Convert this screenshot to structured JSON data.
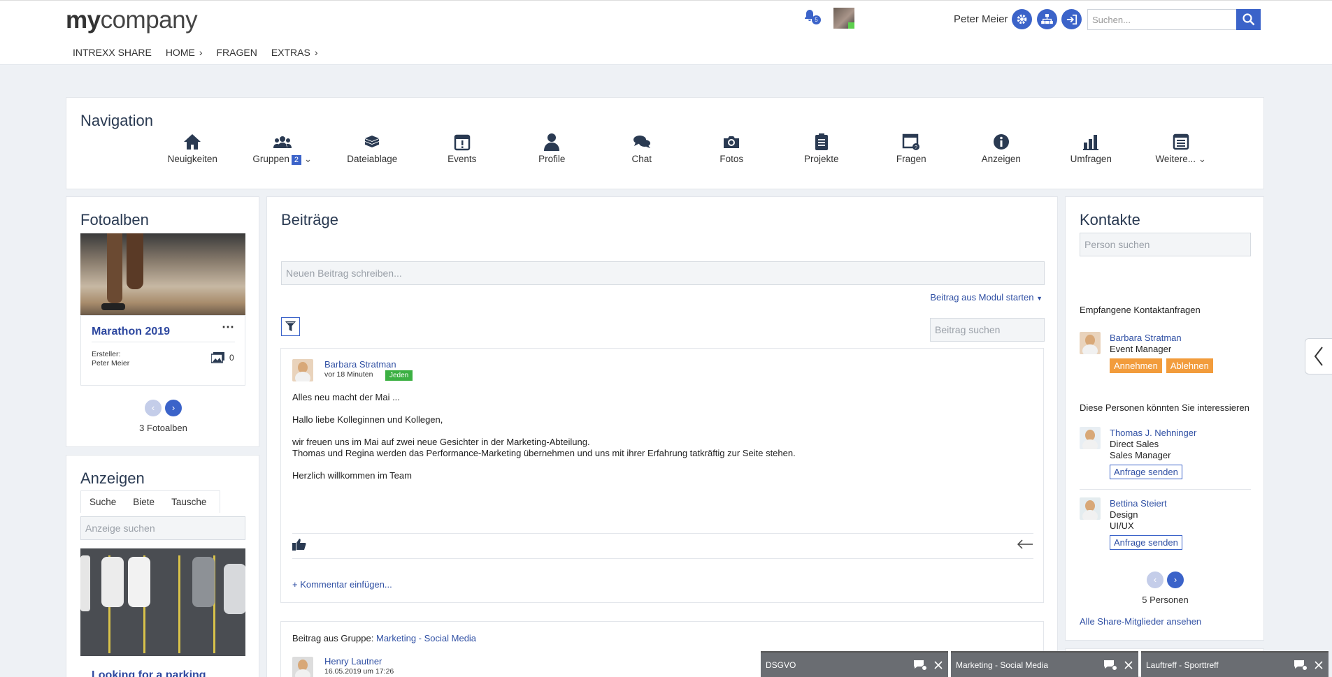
{
  "header": {
    "logo_bold": "my",
    "logo_rest": "company",
    "nav": [
      "INTREXX SHARE",
      "HOME",
      "FRAGEN",
      "EXTRAS"
    ],
    "notification_count": "5",
    "user_name": "Peter Meier",
    "search_placeholder": "Suchen..."
  },
  "navigation": {
    "title": "Navigation",
    "items": [
      {
        "label": "Neuigkeiten",
        "icon": "home-icon"
      },
      {
        "label": "Gruppen",
        "icon": "group-icon",
        "badge": "2"
      },
      {
        "label": "Dateiablage",
        "icon": "files-icon"
      },
      {
        "label": "Events",
        "icon": "calendar-icon"
      },
      {
        "label": "Profile",
        "icon": "person-icon"
      },
      {
        "label": "Chat",
        "icon": "chat-icon"
      },
      {
        "label": "Fotos",
        "icon": "camera-icon"
      },
      {
        "label": "Projekte",
        "icon": "clipboard-icon"
      },
      {
        "label": "Fragen",
        "icon": "question-window-icon"
      },
      {
        "label": "Anzeigen",
        "icon": "info-icon"
      },
      {
        "label": "Umfragen",
        "icon": "bar-chart-icon"
      },
      {
        "label": "Weitere...",
        "icon": "list-icon"
      }
    ]
  },
  "fotoalben": {
    "title": "Fotoalben",
    "album_title": "Marathon 2019",
    "creator_label": "Ersteller:",
    "creator": "Peter Meier",
    "photo_count": "0",
    "count_label": "3 Fotoalben"
  },
  "anzeigen": {
    "title": "Anzeigen",
    "tabs": [
      "Suche",
      "Biete",
      "Tausche"
    ],
    "search_placeholder": "Anzeige suchen",
    "item_title": "Looking for a parking"
  },
  "beitraege": {
    "title": "Beiträge",
    "new_post_placeholder": "Neuen Beitrag schreiben...",
    "module_link": "Beitrag aus Modul starten",
    "search_placeholder": "Beitrag suchen",
    "post1": {
      "author": "Barbara Stratman",
      "time": "vor 18 Minuten",
      "visibility": "Jeden",
      "line1": "Alles neu macht der Mai ...",
      "line2": "Hallo liebe Kolleginnen und Kollegen,",
      "line3": "wir freuen uns im Mai auf zwei neue Gesichter in der Marketing-Abteilung.",
      "line4": "Thomas und Regina werden das Performance-Marketing übernehmen und uns mit ihrer Erfahrung tatkräftig zur Seite stehen.",
      "line5": "Herzlich willkommen im Team",
      "comment_link": "+ Kommentar einfügen..."
    },
    "post2": {
      "group_prefix": "Beitrag aus Gruppe:",
      "group": "Marketing - Social Media",
      "author": "Henry Lautner",
      "time": "16.05.2019 um 17:26"
    }
  },
  "kontakte": {
    "title": "Kontakte",
    "search_placeholder": "Person suchen",
    "requests_title": "Empfangene Kontaktanfragen",
    "request": {
      "name": "Barbara Stratman",
      "role": "Event Manager",
      "accept": "Annehmen",
      "decline": "Ablehnen"
    },
    "suggest_title": "Diese Personen könnten Sie interessieren",
    "suggestions": [
      {
        "name": "Thomas J. Nehninger",
        "line1": "Direct Sales",
        "line2": "Sales Manager",
        "action": "Anfrage senden"
      },
      {
        "name": "Bettina Steiert",
        "line1": "Design",
        "line2": "UI/UX",
        "action": "Anfrage senden"
      }
    ],
    "count_label": "5 Personen",
    "all_link": "Alle Share-Mitglieder ansehen"
  },
  "chatbars": [
    "DSGVO",
    "Marketing - Social Media",
    "Lauftreff - Sporttreff"
  ],
  "colors": {
    "accent": "#3b63c9",
    "orange": "#f29c3c",
    "green": "#3cb043",
    "heading": "#2a3a52"
  }
}
